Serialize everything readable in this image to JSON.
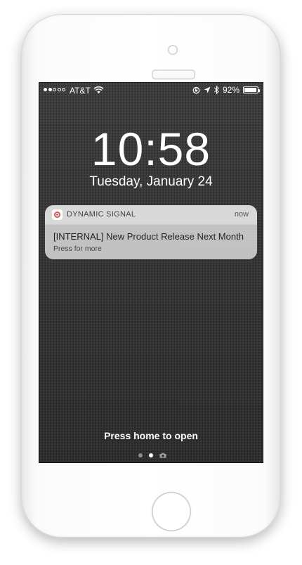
{
  "status_bar": {
    "signal_bars": 2,
    "carrier": "AT&T",
    "battery_percent": "92%",
    "icons": [
      "wifi-icon",
      "lock-rotation-icon",
      "location-icon",
      "bluetooth-icon",
      "battery-icon"
    ]
  },
  "lock_screen": {
    "time": "10:58",
    "date": "Tuesday, January 24",
    "unlock_hint": "Press home to open"
  },
  "notification": {
    "app_name": "DYNAMIC SIGNAL",
    "time": "now",
    "title": "[INTERNAL] New Product Release Next Month",
    "subtitle": "Press for more"
  },
  "page_indicator": {
    "active_page": 1,
    "pages": [
      "dot",
      "dot",
      "camera"
    ]
  },
  "colors": {
    "screen_background": "#2f2f2f",
    "notification_background": "#e1e1e1",
    "app_icon_accent": "#d9534f"
  }
}
